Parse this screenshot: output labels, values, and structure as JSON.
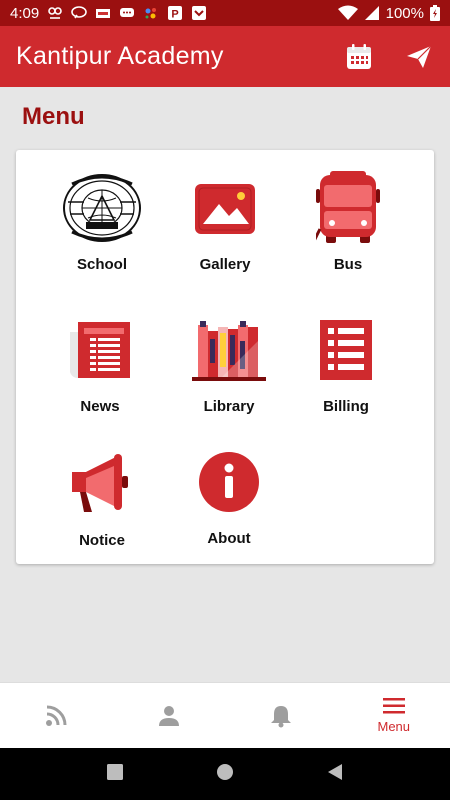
{
  "status": {
    "time": "4:09",
    "battery": "100%"
  },
  "app": {
    "title": "Kantipur Academy"
  },
  "page": {
    "title": "Menu"
  },
  "menu": [
    {
      "label": "School",
      "icon": "school-logo-icon"
    },
    {
      "label": "Gallery",
      "icon": "gallery-icon"
    },
    {
      "label": "Bus",
      "icon": "bus-icon"
    },
    {
      "label": "News",
      "icon": "news-icon"
    },
    {
      "label": "Library",
      "icon": "library-icon"
    },
    {
      "label": "Billing",
      "icon": "billing-icon"
    },
    {
      "label": "Notice",
      "icon": "megaphone-icon"
    },
    {
      "label": "About",
      "icon": "info-icon"
    }
  ],
  "bottom_nav": [
    {
      "icon": "rss-icon",
      "label": ""
    },
    {
      "icon": "person-icon",
      "label": ""
    },
    {
      "icon": "bell-icon",
      "label": ""
    },
    {
      "icon": "hamburger-menu-icon",
      "label": "Menu",
      "active": true
    }
  ],
  "colors": {
    "status_bar": "#9b1010",
    "app_bar": "#cf2a2e",
    "accent": "#cf2a2e",
    "icon_light": "#f26b6e",
    "background": "#e6e6e6"
  }
}
